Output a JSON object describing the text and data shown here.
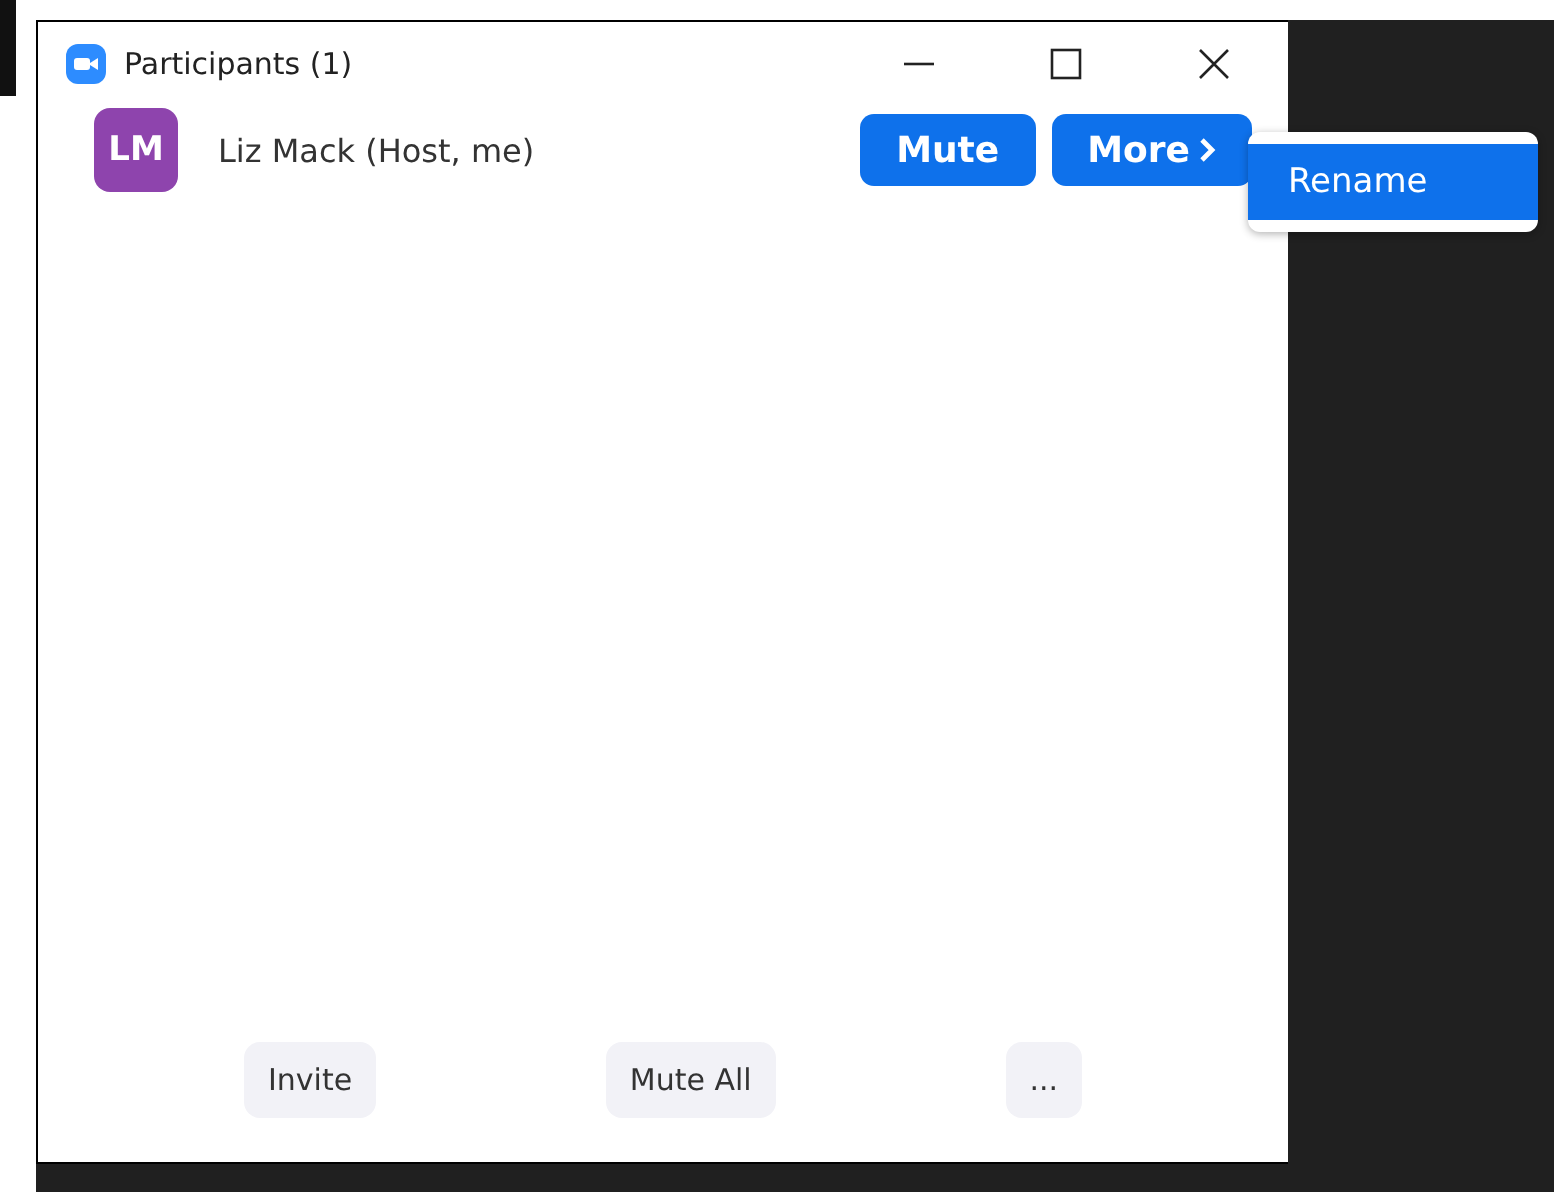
{
  "window": {
    "title": "Participants (1)"
  },
  "participants": [
    {
      "initials": "LM",
      "color": "#8e44ad",
      "name": "Liz Mack (Host, me)",
      "actions": [
        "Mute",
        "More"
      ]
    }
  ],
  "menu": {
    "items": [
      {
        "label": "Rename",
        "selected": true
      }
    ]
  },
  "footer": {
    "buttons": [
      "Invite",
      "Mute All",
      "..."
    ]
  }
}
